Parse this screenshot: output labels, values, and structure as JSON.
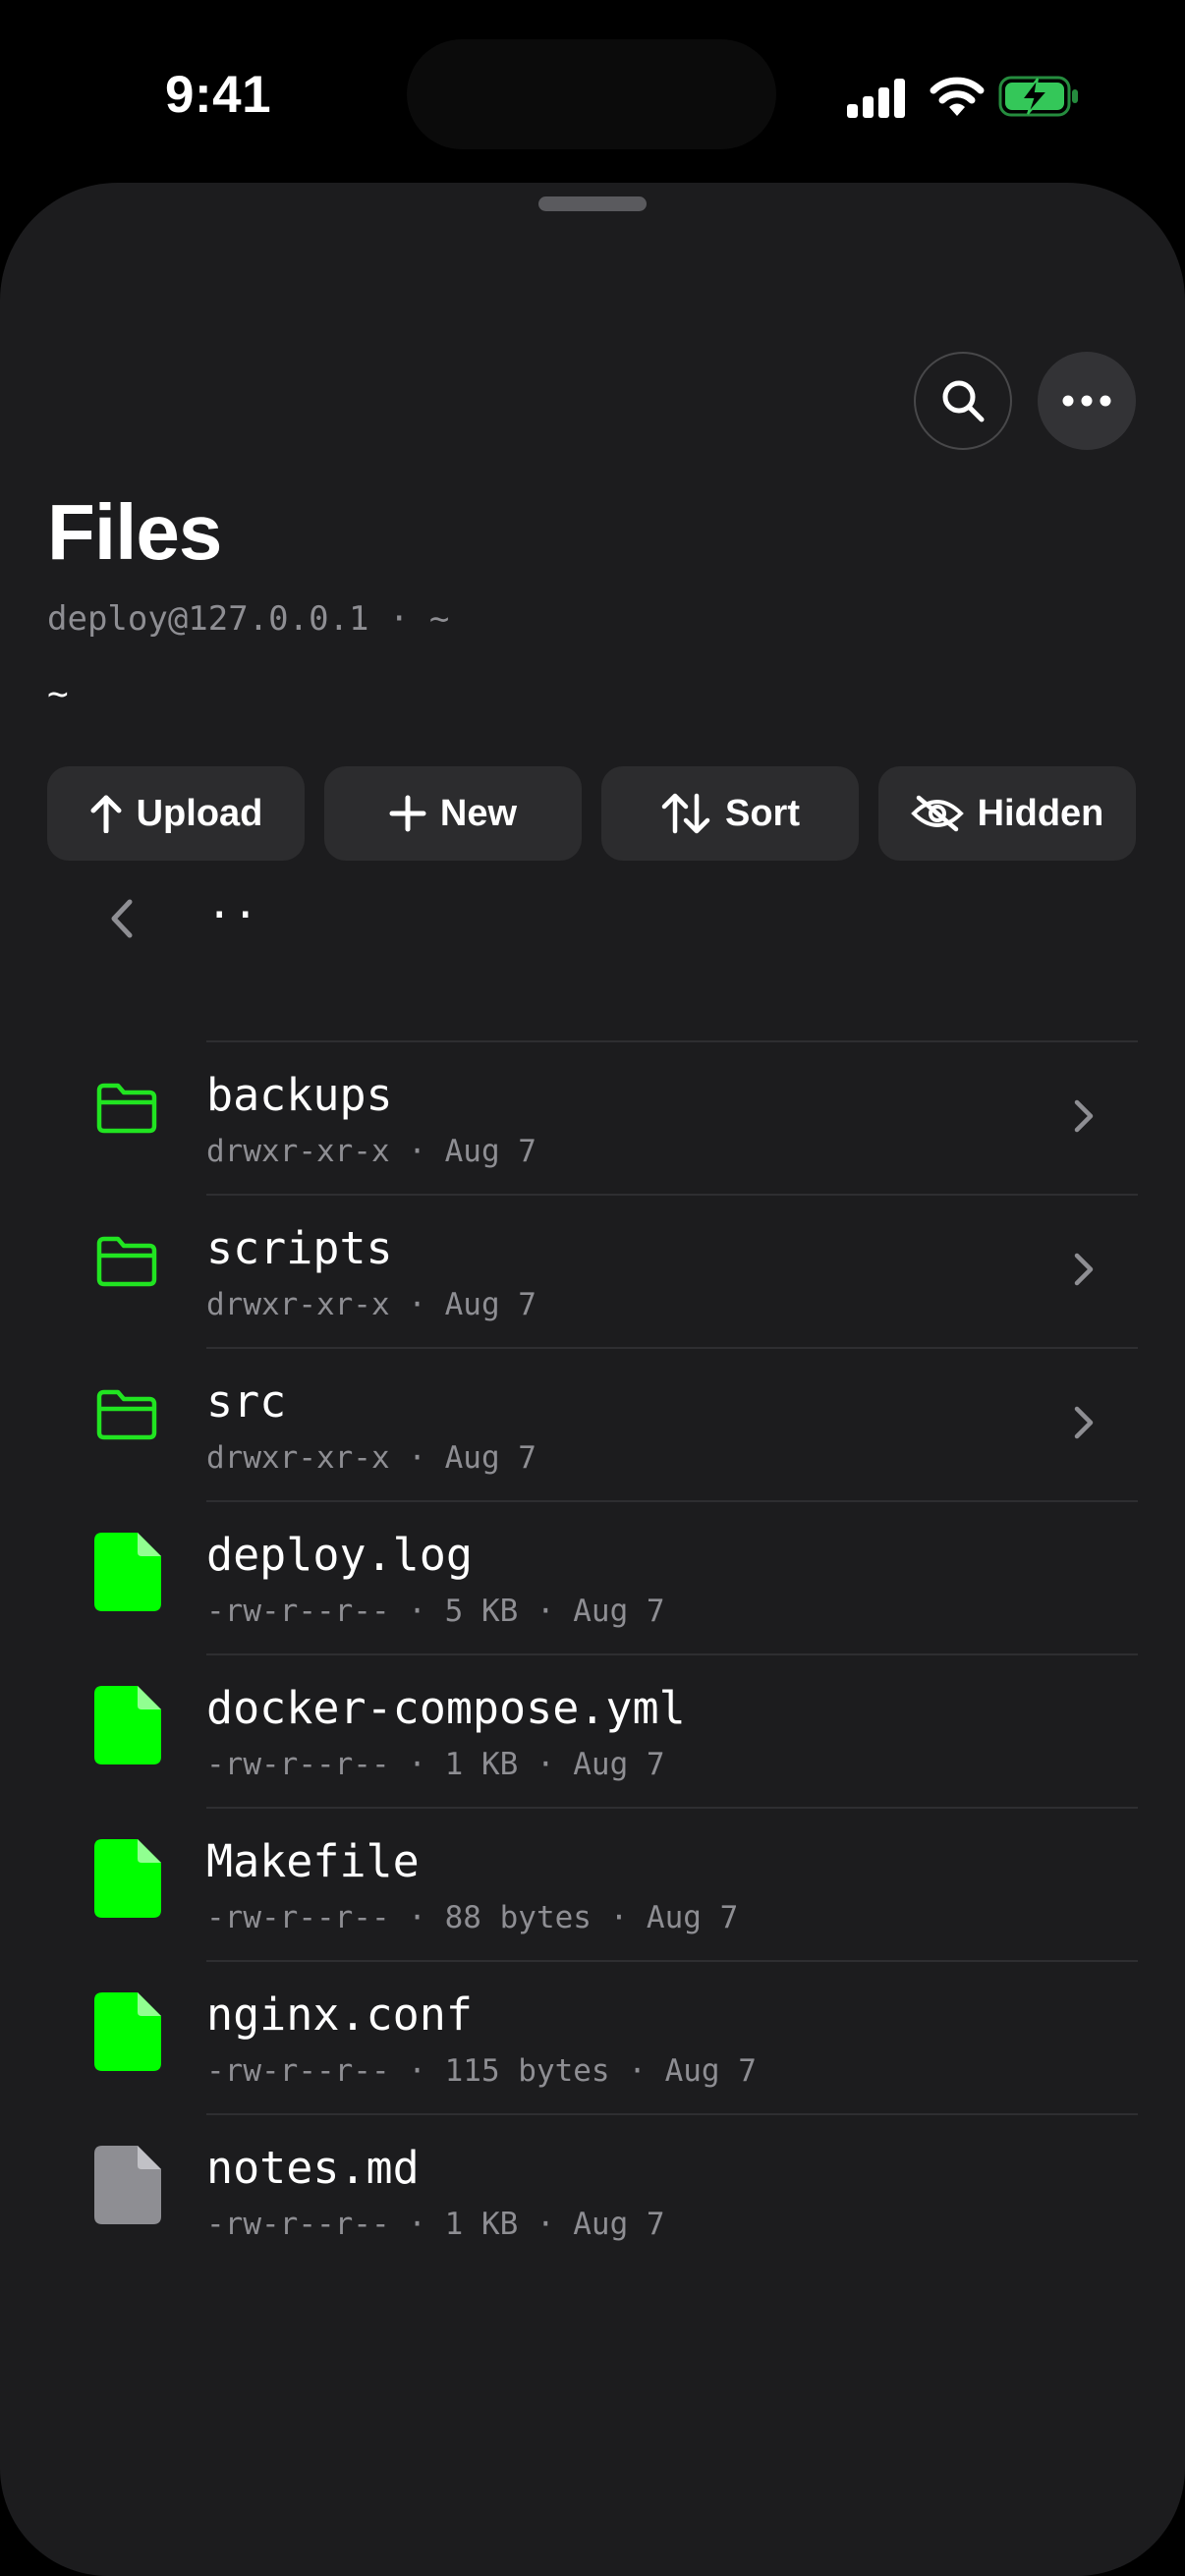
{
  "status_bar": {
    "time": "9:41"
  },
  "header": {
    "title": "Files",
    "subtitle": "deploy@127.0.0.1 · ~",
    "path": "~",
    "search_icon": "search-icon",
    "more_icon": "ellipsis-icon"
  },
  "actions": [
    {
      "label": "Upload",
      "icon": "arrow-up-icon"
    },
    {
      "label": "New",
      "icon": "plus-icon"
    },
    {
      "label": "Sort",
      "icon": "sort-arrows-icon"
    },
    {
      "label": "Hidden",
      "icon": "eye-slash-icon"
    }
  ],
  "list": {
    "parent": {
      "label": "..",
      "icon": "chevron-left-icon"
    },
    "items": [
      {
        "name": "backups",
        "meta": "drwxr-xr-x · Aug 7",
        "type": "folder"
      },
      {
        "name": "scripts",
        "meta": "drwxr-xr-x · Aug 7",
        "type": "folder"
      },
      {
        "name": "src",
        "meta": "drwxr-xr-x · Aug 7",
        "type": "folder"
      },
      {
        "name": "deploy.log",
        "meta": "-rw-r--r-- · 5 KB · Aug 7",
        "type": "file"
      },
      {
        "name": "docker-compose.yml",
        "meta": "-rw-r--r-- · 1 KB · Aug 7",
        "type": "file"
      },
      {
        "name": "Makefile",
        "meta": "-rw-r--r-- · 88 bytes · Aug 7",
        "type": "file"
      },
      {
        "name": "nginx.conf",
        "meta": "-rw-r--r-- · 115 bytes · Aug 7",
        "type": "file"
      },
      {
        "name": "notes.md",
        "meta": "-rw-r--r-- · 1 KB · Aug 7",
        "type": "file-gray"
      }
    ]
  },
  "colors": {
    "accent": "#21e421",
    "file_green": "#00ff00",
    "file_gray": "#8e8e93",
    "background": "#1c1c1e",
    "button": "#2c2c2e"
  }
}
